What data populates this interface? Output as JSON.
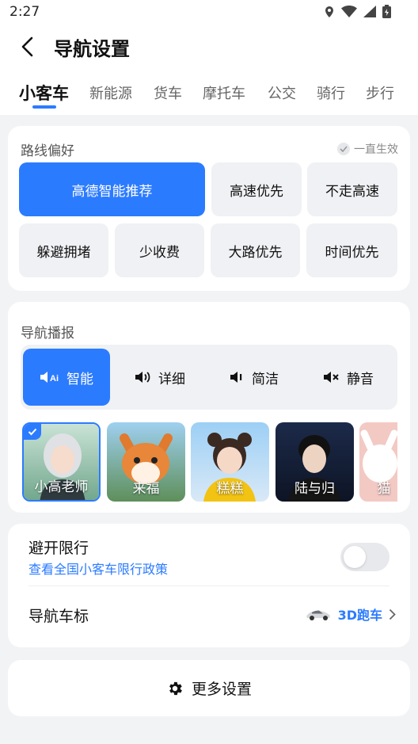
{
  "status": {
    "time": "2:27"
  },
  "header": {
    "title": "导航设置"
  },
  "tabs": [
    "小客车",
    "新能源",
    "货车",
    "摩托车",
    "公交",
    "骑行",
    "步行"
  ],
  "route": {
    "title": "路线偏好",
    "always_label": "一直生效",
    "options": [
      "高德智能推荐",
      "高速优先",
      "不走高速",
      "躲避拥堵",
      "少收费",
      "大路优先",
      "时间优先"
    ]
  },
  "broadcast": {
    "title": "导航播报",
    "modes": [
      "智能",
      "详细",
      "简洁",
      "静音"
    ],
    "voices": [
      "小高老师",
      "来福",
      "糕糕",
      "陆与归",
      "猫"
    ]
  },
  "restrict": {
    "title": "避开限行",
    "link": "查看全国小客车限行政策"
  },
  "car_icon": {
    "title": "导航车标",
    "value": "3D跑车"
  },
  "more": {
    "label": "更多设置"
  },
  "colors": {
    "accent": "#2b7bff",
    "background": "#f2f3f5"
  }
}
